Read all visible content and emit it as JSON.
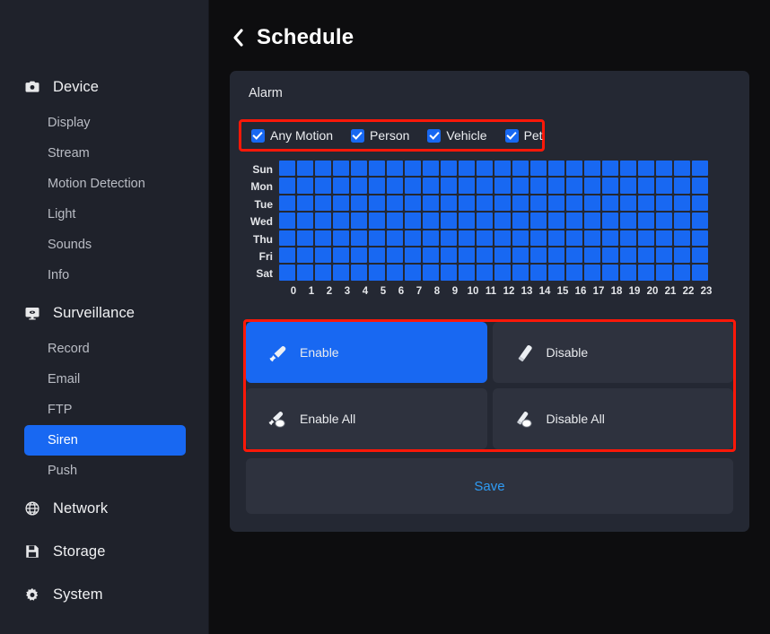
{
  "sidebar": {
    "groups": [
      {
        "label": "Device",
        "icon": "camera-icon",
        "items": [
          {
            "label": "Display",
            "active": false
          },
          {
            "label": "Stream",
            "active": false
          },
          {
            "label": "Motion Detection",
            "active": false
          },
          {
            "label": "Light",
            "active": false
          },
          {
            "label": "Sounds",
            "active": false
          },
          {
            "label": "Info",
            "active": false
          }
        ]
      },
      {
        "label": "Surveillance",
        "icon": "monitor-icon",
        "items": [
          {
            "label": "Record",
            "active": false
          },
          {
            "label": "Email",
            "active": false
          },
          {
            "label": "FTP",
            "active": false
          },
          {
            "label": "Siren",
            "active": true
          },
          {
            "label": "Push",
            "active": false
          }
        ]
      },
      {
        "label": "Network",
        "icon": "globe-icon",
        "items": []
      },
      {
        "label": "Storage",
        "icon": "floppy-disk-icon",
        "items": []
      },
      {
        "label": "System",
        "icon": "gear-icon",
        "items": []
      }
    ]
  },
  "header": {
    "back_icon": "chevron-left-icon",
    "title": "Schedule"
  },
  "card": {
    "section_title": "Alarm",
    "filters": [
      {
        "label": "Any Motion",
        "checked": true
      },
      {
        "label": "Person",
        "checked": true
      },
      {
        "label": "Vehicle",
        "checked": true
      },
      {
        "label": "Pet",
        "checked": true
      }
    ],
    "schedule": {
      "days": [
        "Sun",
        "Mon",
        "Tue",
        "Wed",
        "Thu",
        "Fri",
        "Sat"
      ],
      "hours": [
        "0",
        "1",
        "2",
        "3",
        "4",
        "5",
        "6",
        "7",
        "8",
        "9",
        "10",
        "11",
        "12",
        "13",
        "14",
        "15",
        "16",
        "17",
        "18",
        "19",
        "20",
        "21",
        "22",
        "23"
      ],
      "cells": [
        [
          1,
          1,
          1,
          1,
          1,
          1,
          1,
          1,
          1,
          1,
          1,
          1,
          1,
          1,
          1,
          1,
          1,
          1,
          1,
          1,
          1,
          1,
          1,
          1
        ],
        [
          1,
          1,
          1,
          1,
          1,
          1,
          1,
          1,
          1,
          1,
          1,
          1,
          1,
          1,
          1,
          1,
          1,
          1,
          1,
          1,
          1,
          1,
          1,
          1
        ],
        [
          1,
          1,
          1,
          1,
          1,
          1,
          1,
          1,
          1,
          1,
          1,
          1,
          1,
          1,
          1,
          1,
          1,
          1,
          1,
          1,
          1,
          1,
          1,
          1
        ],
        [
          1,
          1,
          1,
          1,
          1,
          1,
          1,
          1,
          1,
          1,
          1,
          1,
          1,
          1,
          1,
          1,
          1,
          1,
          1,
          1,
          1,
          1,
          1,
          1
        ],
        [
          1,
          1,
          1,
          1,
          1,
          1,
          1,
          1,
          1,
          1,
          1,
          1,
          1,
          1,
          1,
          1,
          1,
          1,
          1,
          1,
          1,
          1,
          1,
          1
        ],
        [
          1,
          1,
          1,
          1,
          1,
          1,
          1,
          1,
          1,
          1,
          1,
          1,
          1,
          1,
          1,
          1,
          1,
          1,
          1,
          1,
          1,
          1,
          1,
          1
        ],
        [
          1,
          1,
          1,
          1,
          1,
          1,
          1,
          1,
          1,
          1,
          1,
          1,
          1,
          1,
          1,
          1,
          1,
          1,
          1,
          1,
          1,
          1,
          1,
          1
        ]
      ]
    },
    "actions": [
      {
        "label": "Enable",
        "icon": "brush-icon",
        "selected": true
      },
      {
        "label": "Disable",
        "icon": "eraser-icon",
        "selected": false
      },
      {
        "label": "Enable All",
        "icon": "brush-all-icon",
        "selected": false
      },
      {
        "label": "Disable All",
        "icon": "eraser-all-icon",
        "selected": false
      }
    ],
    "save_label": "Save"
  },
  "colors": {
    "accent_blue": "#1868f2",
    "highlight_red": "#fe1808",
    "card_bg": "#242833",
    "sidebar_bg": "#1f222b",
    "page_bg": "#0d0d0f",
    "save_text": "#2f9cf5"
  }
}
